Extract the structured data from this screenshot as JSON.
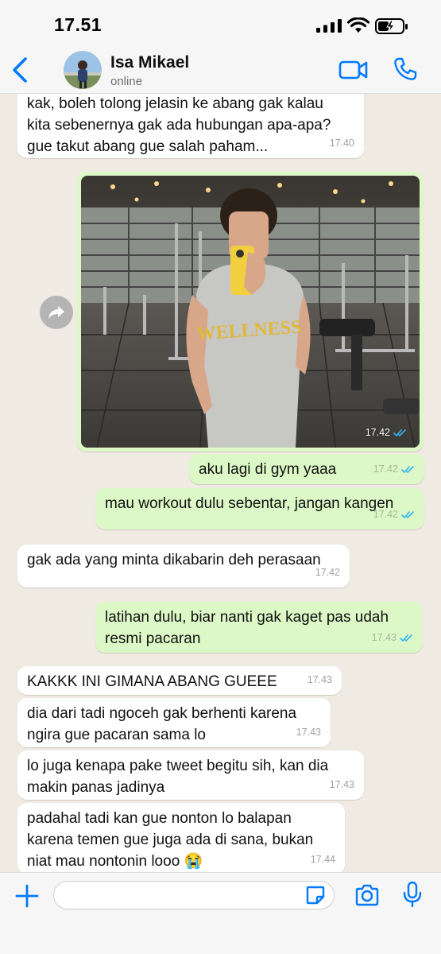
{
  "status_bar": {
    "time": "17.51"
  },
  "header": {
    "name": "Isa Mikael",
    "status": "online"
  },
  "messages": [
    {
      "dir": "in",
      "text": "kak, boleh tolong jelasin ke abang gak kalau\nkita sebenernya gak ada hubungan apa-apa?\ngue takut abang gue salah paham...",
      "time": "17.40"
    },
    {
      "dir": "out",
      "type": "photo",
      "time": "17.42",
      "read": true,
      "photo_text": "WELLNESS"
    },
    {
      "dir": "out",
      "text": "aku lagi di gym yaaa",
      "time": "17.42",
      "read": true
    },
    {
      "dir": "out",
      "text": "mau workout dulu sebentar, jangan kangen",
      "time": "17.42",
      "read": true
    },
    {
      "dir": "in",
      "text": "gak ada yang minta dikabarin deh perasaan",
      "time": "17.42"
    },
    {
      "dir": "out",
      "text": "latihan dulu, biar nanti gak kaget pas udah\nresmi pacaran",
      "time": "17.43",
      "read": true
    },
    {
      "dir": "in",
      "text": "KAKKK INI GIMANA ABANG GUEEE",
      "time": "17.43"
    },
    {
      "dir": "in",
      "text": "dia dari tadi ngoceh gak berhenti karena\nngira gue pacaran sama lo",
      "time": "17.43"
    },
    {
      "dir": "in",
      "text": "lo juga kenapa pake tweet begitu sih, kan dia\nmakin panas jadinya",
      "time": "17.43"
    },
    {
      "dir": "in",
      "text": "padahal tadi kan gue nonton lo balapan\nkarena temen gue juga ada di sana, bukan\nniat mau nontonin looo 😭",
      "time": "17.44"
    }
  ],
  "composer": {
    "value": ""
  },
  "colors": {
    "accent": "#007aff",
    "outgoing": "#dcf8c6",
    "incoming": "#ffffff",
    "read_ticks": "#34b7f1"
  },
  "icons": [
    "back-chevron-icon",
    "video-call-icon",
    "phone-icon",
    "forward-icon",
    "plus-icon",
    "sticker-icon",
    "camera-icon",
    "microphone-icon"
  ]
}
